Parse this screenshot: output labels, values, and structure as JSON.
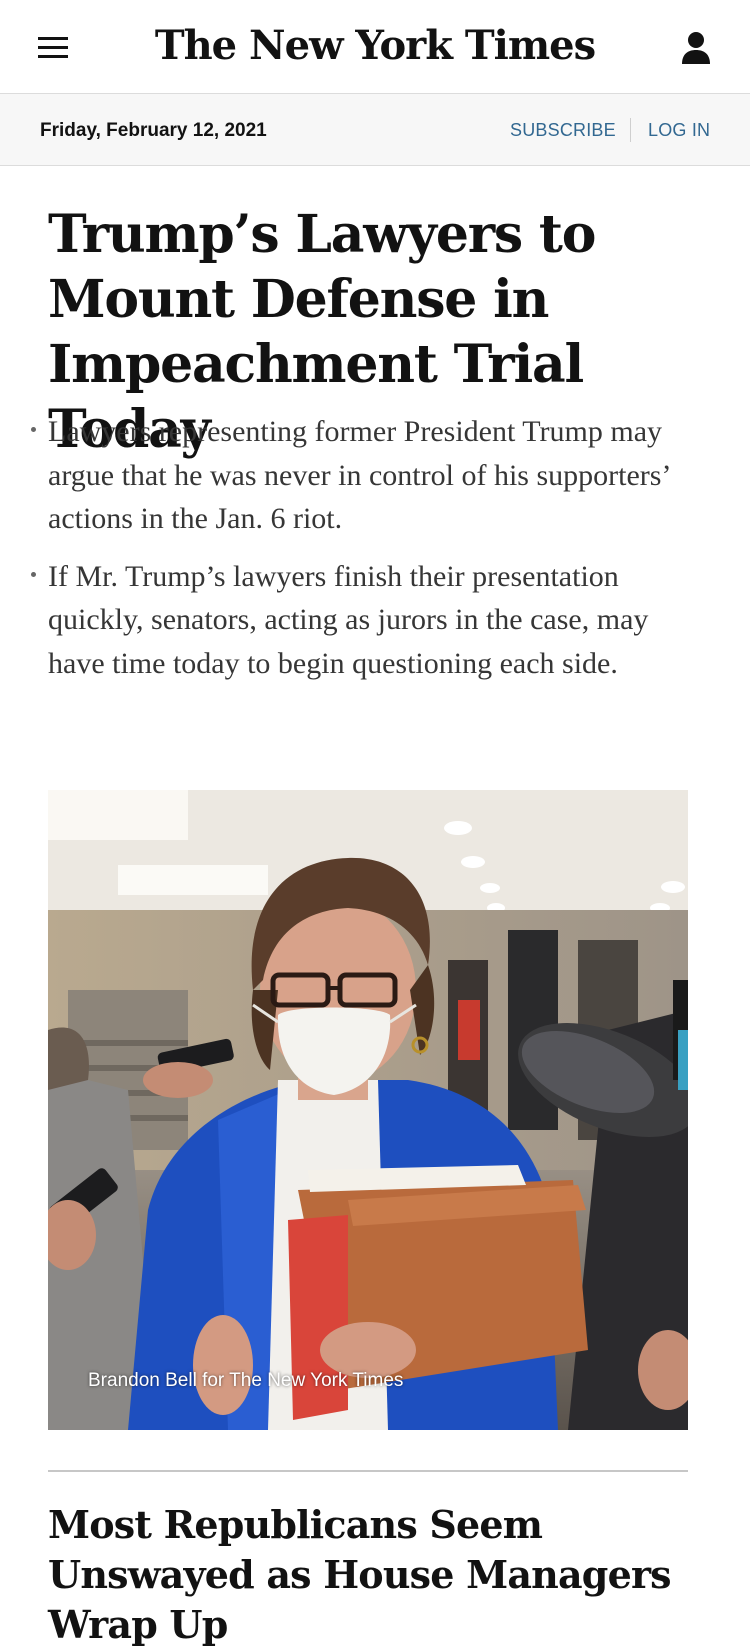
{
  "header": {
    "menu_icon": "hamburger-menu-icon",
    "logo_text": "The New York Times",
    "account_icon": "user-account-icon"
  },
  "datebar": {
    "date": "Friday, February 12, 2021",
    "subscribe_label": "SUBSCRIBE",
    "login_label": "LOG IN",
    "link_color": "#326891"
  },
  "lead_story": {
    "headline": "Trump’s Lawyers to Mount Defense in Impeachment Trial Today",
    "summary": [
      "Lawyers representing former President Trump may argue that he was never in control of his supporters’ actions in the Jan. 6 riot.",
      "If Mr. Trump’s lawyers finish their presentation quickly, senators, acting as jurors in the case, may have time today to begin questioning each side."
    ],
    "photo_credit": "Brandon Bell for The New York Times"
  },
  "second_story": {
    "headline": "Most Republicans Seem Unswayed as House Managers Wrap Up"
  }
}
